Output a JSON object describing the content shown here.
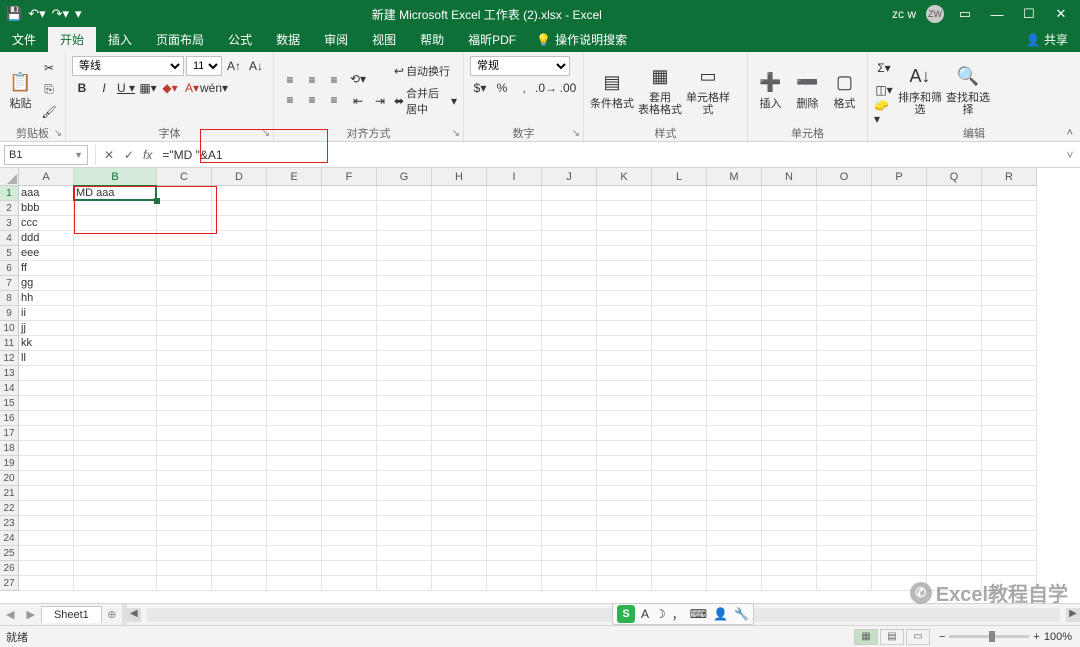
{
  "titlebar": {
    "title": "新建 Microsoft Excel 工作表 (2).xlsx  -  Excel",
    "username": "zc w",
    "avatar_initials": "ZW"
  },
  "tabs": [
    "文件",
    "开始",
    "插入",
    "页面布局",
    "公式",
    "数据",
    "审阅",
    "视图",
    "帮助",
    "福昕PDF"
  ],
  "active_tab": "开始",
  "tellme": "操作说明搜索",
  "share": "共享",
  "ribbon": {
    "clipboard": {
      "label": "剪贴板",
      "paste": "粘贴"
    },
    "font": {
      "label": "字体",
      "name": "等线",
      "size": "11"
    },
    "alignment": {
      "label": "对齐方式",
      "wrap": "自动换行",
      "merge": "合并后居中"
    },
    "number": {
      "label": "数字",
      "format": "常规"
    },
    "styles": {
      "label": "样式",
      "cond": "条件格式",
      "table": "套用\n表格格式",
      "cell": "单元格样式"
    },
    "cells": {
      "label": "单元格",
      "insert": "插入",
      "delete": "删除",
      "format": "格式"
    },
    "editing": {
      "label": "编辑",
      "sort": "排序和筛选",
      "find": "查找和选择"
    }
  },
  "namebox": "B1",
  "formula": "=\"MD \"&A1",
  "columns": [
    "A",
    "B",
    "C",
    "D",
    "E",
    "F",
    "G",
    "H",
    "I",
    "J",
    "K",
    "L",
    "M",
    "N",
    "O",
    "P",
    "Q",
    "R"
  ],
  "rows": 27,
  "cells": {
    "A1": "aaa",
    "A2": "bbb",
    "A3": "ccc",
    "A4": "ddd",
    "A5": "eee",
    "A6": "ff",
    "A7": "gg",
    "A8": "hh",
    "A9": "ii",
    "A10": "jj",
    "A11": "kk",
    "A12": "ll",
    "B1": "MD aaa"
  },
  "active_cell": "B1",
  "sheet": {
    "name": "Sheet1"
  },
  "status": {
    "ready": "就绪",
    "zoom": "100%"
  },
  "watermark": "Excel教程自学"
}
